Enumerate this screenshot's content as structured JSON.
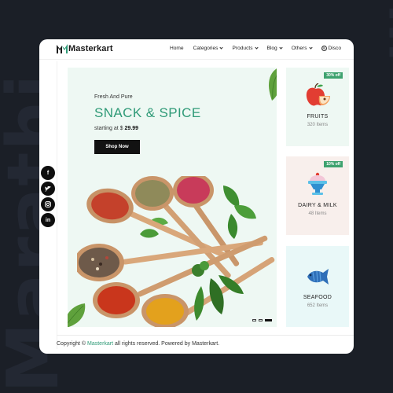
{
  "background": {
    "left_word": "Marathi",
    "right_word": "Ecom"
  },
  "brand": {
    "name": "Masterkart",
    "accent": "#2f9a77"
  },
  "nav": {
    "items": [
      {
        "label": "Home",
        "dropdown": false
      },
      {
        "label": "Categories",
        "dropdown": true
      },
      {
        "label": "Products",
        "dropdown": true
      },
      {
        "label": "Blog",
        "dropdown": true
      },
      {
        "label": "Others",
        "dropdown": true
      }
    ],
    "discount_label": "Disco"
  },
  "hero": {
    "subtitle": "Fresh And Pure",
    "title": "SNACK & SPICE",
    "price_prefix": "starting at $",
    "price": "29.99",
    "button": "Shop Now"
  },
  "categories": [
    {
      "name": "FRUITS",
      "count": "320 Items",
      "badge": "30% off",
      "icon": "apple-icon"
    },
    {
      "name": "DAIRY & MILK",
      "count": "48 Items",
      "badge": "10% off",
      "icon": "dessert-icon"
    },
    {
      "name": "SEAFOOD",
      "count": "652 Items",
      "badge": "",
      "icon": "fish-icon"
    }
  ],
  "social": [
    "f",
    "t",
    "ig",
    "in"
  ],
  "footer": {
    "prefix": "Copyright ©",
    "brand": "Masterkart",
    "suffix": "all rights reserved. Powered by Masterkart."
  }
}
